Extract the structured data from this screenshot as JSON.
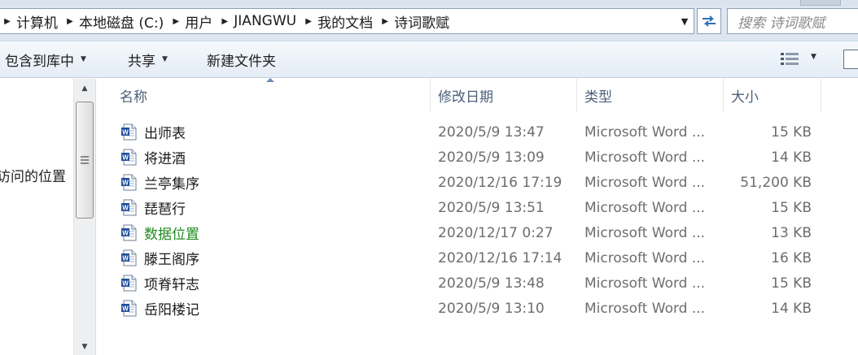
{
  "address_bar": {
    "crumbs": [
      "计算机",
      "本地磁盘 (C:)",
      "用户",
      "JIANGWU",
      "我的文档",
      "诗词歌赋"
    ],
    "search_placeholder": "搜索 诗词歌赋"
  },
  "toolbar": {
    "include_library": "包含到库中",
    "share": "共享",
    "new_folder": "新建文件夹"
  },
  "nav_pane": {
    "visible_item": "访问的位置"
  },
  "columns": {
    "name": "名称",
    "date": "修改日期",
    "type": "类型",
    "size": "大小"
  },
  "files": [
    {
      "name": "出师表",
      "date": "2020/5/9 13:47",
      "type": "Microsoft Word ...",
      "size": "15 KB"
    },
    {
      "name": "将进酒",
      "date": "2020/5/9 13:09",
      "type": "Microsoft Word ...",
      "size": "14 KB"
    },
    {
      "name": "兰亭集序",
      "date": "2020/12/16 17:19",
      "type": "Microsoft Word ...",
      "size": "51,200 KB"
    },
    {
      "name": "琵琶行",
      "date": "2020/5/9 13:51",
      "type": "Microsoft Word ...",
      "size": "15 KB"
    },
    {
      "name": "数据位置",
      "date": "2020/12/17 0:27",
      "type": "Microsoft Word ...",
      "size": "13 KB"
    },
    {
      "name": "滕王阁序",
      "date": "2020/12/16 17:14",
      "type": "Microsoft Word ...",
      "size": "16 KB"
    },
    {
      "name": "项脊轩志",
      "date": "2020/5/9 13:48",
      "type": "Microsoft Word ...",
      "size": "15 KB"
    },
    {
      "name": "岳阳楼记",
      "date": "2020/5/9 13:10",
      "type": "Microsoft Word ...",
      "size": "14 KB"
    }
  ],
  "colors": {
    "highlight_name": "#1f8a1f",
    "header_text": "#4c607a",
    "meta_text": "#6d6d6d"
  }
}
